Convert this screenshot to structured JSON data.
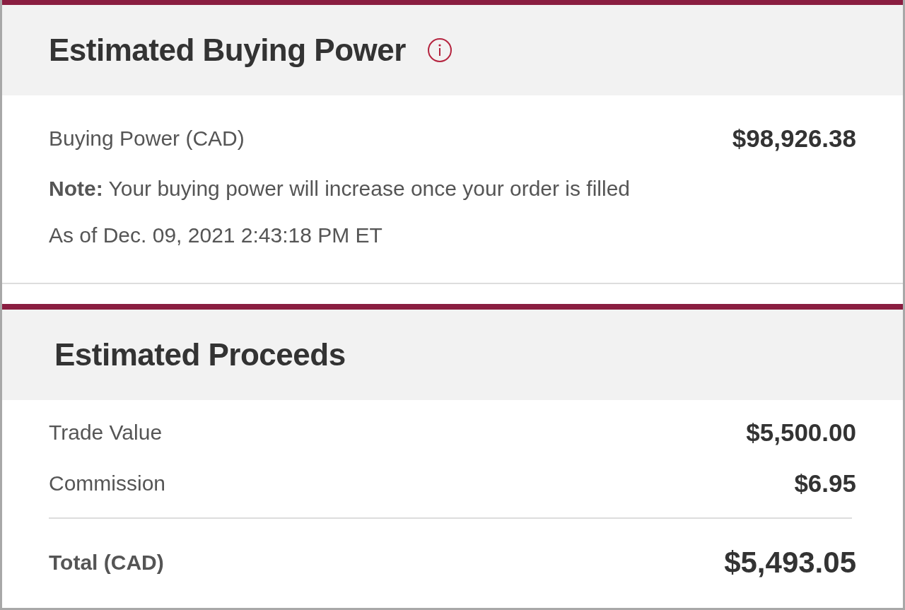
{
  "sections": [
    {
      "title": "Estimated Buying Power",
      "info_icon": true,
      "rows": [
        {
          "kind": "line",
          "label": "Buying Power (CAD)",
          "value": "$98,926.38"
        },
        {
          "kind": "note",
          "text": "**Note:** Your buying power will increase once your order is filled"
        },
        {
          "kind": "text",
          "text": "As of Dec. 09, 2021 2:43:18 PM ET"
        }
      ]
    },
    {
      "title": "Estimated Proceeds",
      "info_icon": false,
      "rows": [
        {
          "kind": "line",
          "label": "Trade Value",
          "value": "$5,500.00"
        },
        {
          "kind": "line",
          "label": "Commission",
          "value": "$6.95"
        },
        {
          "kind": "total",
          "label": "Total (CAD)",
          "value": "$5,493.05"
        }
      ]
    }
  ]
}
